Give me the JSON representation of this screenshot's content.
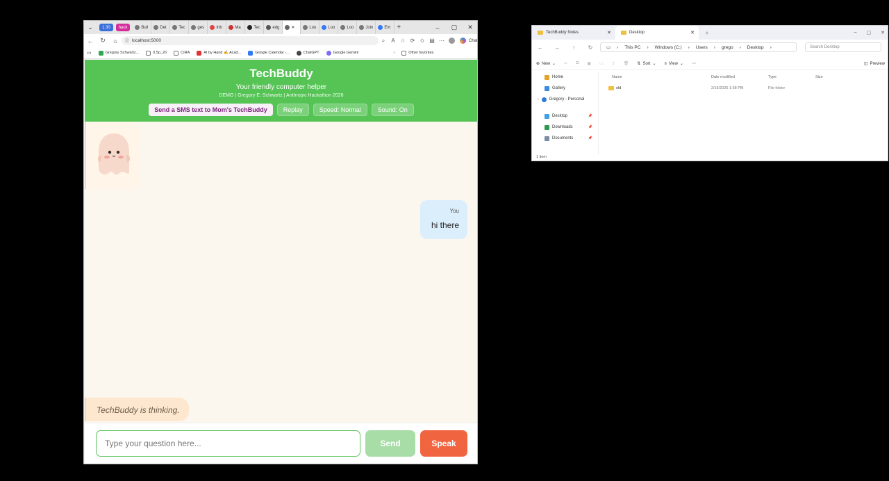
{
  "browser": {
    "tab_groups": [
      {
        "label": "1.30",
        "color": "#3b6fd9"
      },
      {
        "label": "hack",
        "color": "#d62c9c"
      }
    ],
    "tabs": [
      "Buil",
      "Det",
      "Tec",
      "ges",
      "Inb",
      "Ma",
      "Tec",
      "edg",
      "",
      "Loo",
      "Loo",
      "Loo",
      "Join",
      "Em"
    ],
    "url": "localhost:5000",
    "chat_label": "Chat",
    "bookmarks": [
      "Gregory Schwartz...",
      "0.5p_26",
      "CIRA",
      "AI by Hand ✍ Acad...",
      "Google Calendar -...",
      "ChatGPT",
      "Google Gemini"
    ],
    "other_favorites": "Other favorites"
  },
  "app": {
    "title": "TechBuddy",
    "subtitle": "Your friendly computer helper",
    "credits": "DEMO | Gregory E. Schwartz | Anthropic Hackathon 2026",
    "buttons": {
      "sms": "Send a SMS text to Mom's TechBuddy",
      "replay": "Replay",
      "speed": "Speed: Normal",
      "sound": "Sound: On"
    },
    "user_message": {
      "who": "You",
      "text": "hi there"
    },
    "thinking": "TechBuddy is thinking.",
    "input_placeholder": "Type your question here...",
    "send": "Send",
    "speak": "Speak",
    "colors": {
      "header": "#55c455",
      "speak": "#f0643f",
      "send": "#a8dda8"
    }
  },
  "explorer": {
    "tabs": [
      "TechBuddy Notes",
      "Desktop"
    ],
    "path": [
      "This PC",
      "Windows (C:)",
      "Users",
      "grego",
      "Desktop"
    ],
    "search_placeholder": "Search Desktop",
    "commands": {
      "new": "New",
      "sort": "Sort",
      "view": "View",
      "preview": "Preview"
    },
    "sidebar": [
      {
        "label": "Home",
        "color": "#e2a32b",
        "pinned": false
      },
      {
        "label": "Gallery",
        "color": "#3a8be0",
        "pinned": false
      },
      {
        "label": "Gregory - Personal",
        "color": "#2d7bd6",
        "pinned": false
      },
      {
        "label": "Desktop",
        "color": "#3fa0e6",
        "pinned": true
      },
      {
        "label": "Downloads",
        "color": "#2f9a4e",
        "pinned": true
      },
      {
        "label": "Documents",
        "color": "#7b8ca3",
        "pinned": true
      }
    ],
    "columns": {
      "name": "Name",
      "date": "Date modified",
      "type": "Type",
      "size": "Size"
    },
    "rows": [
      {
        "name": "old",
        "date": "2/16/2026 1:58 PM",
        "type": "File folder",
        "size": ""
      }
    ],
    "status": "1 item"
  }
}
